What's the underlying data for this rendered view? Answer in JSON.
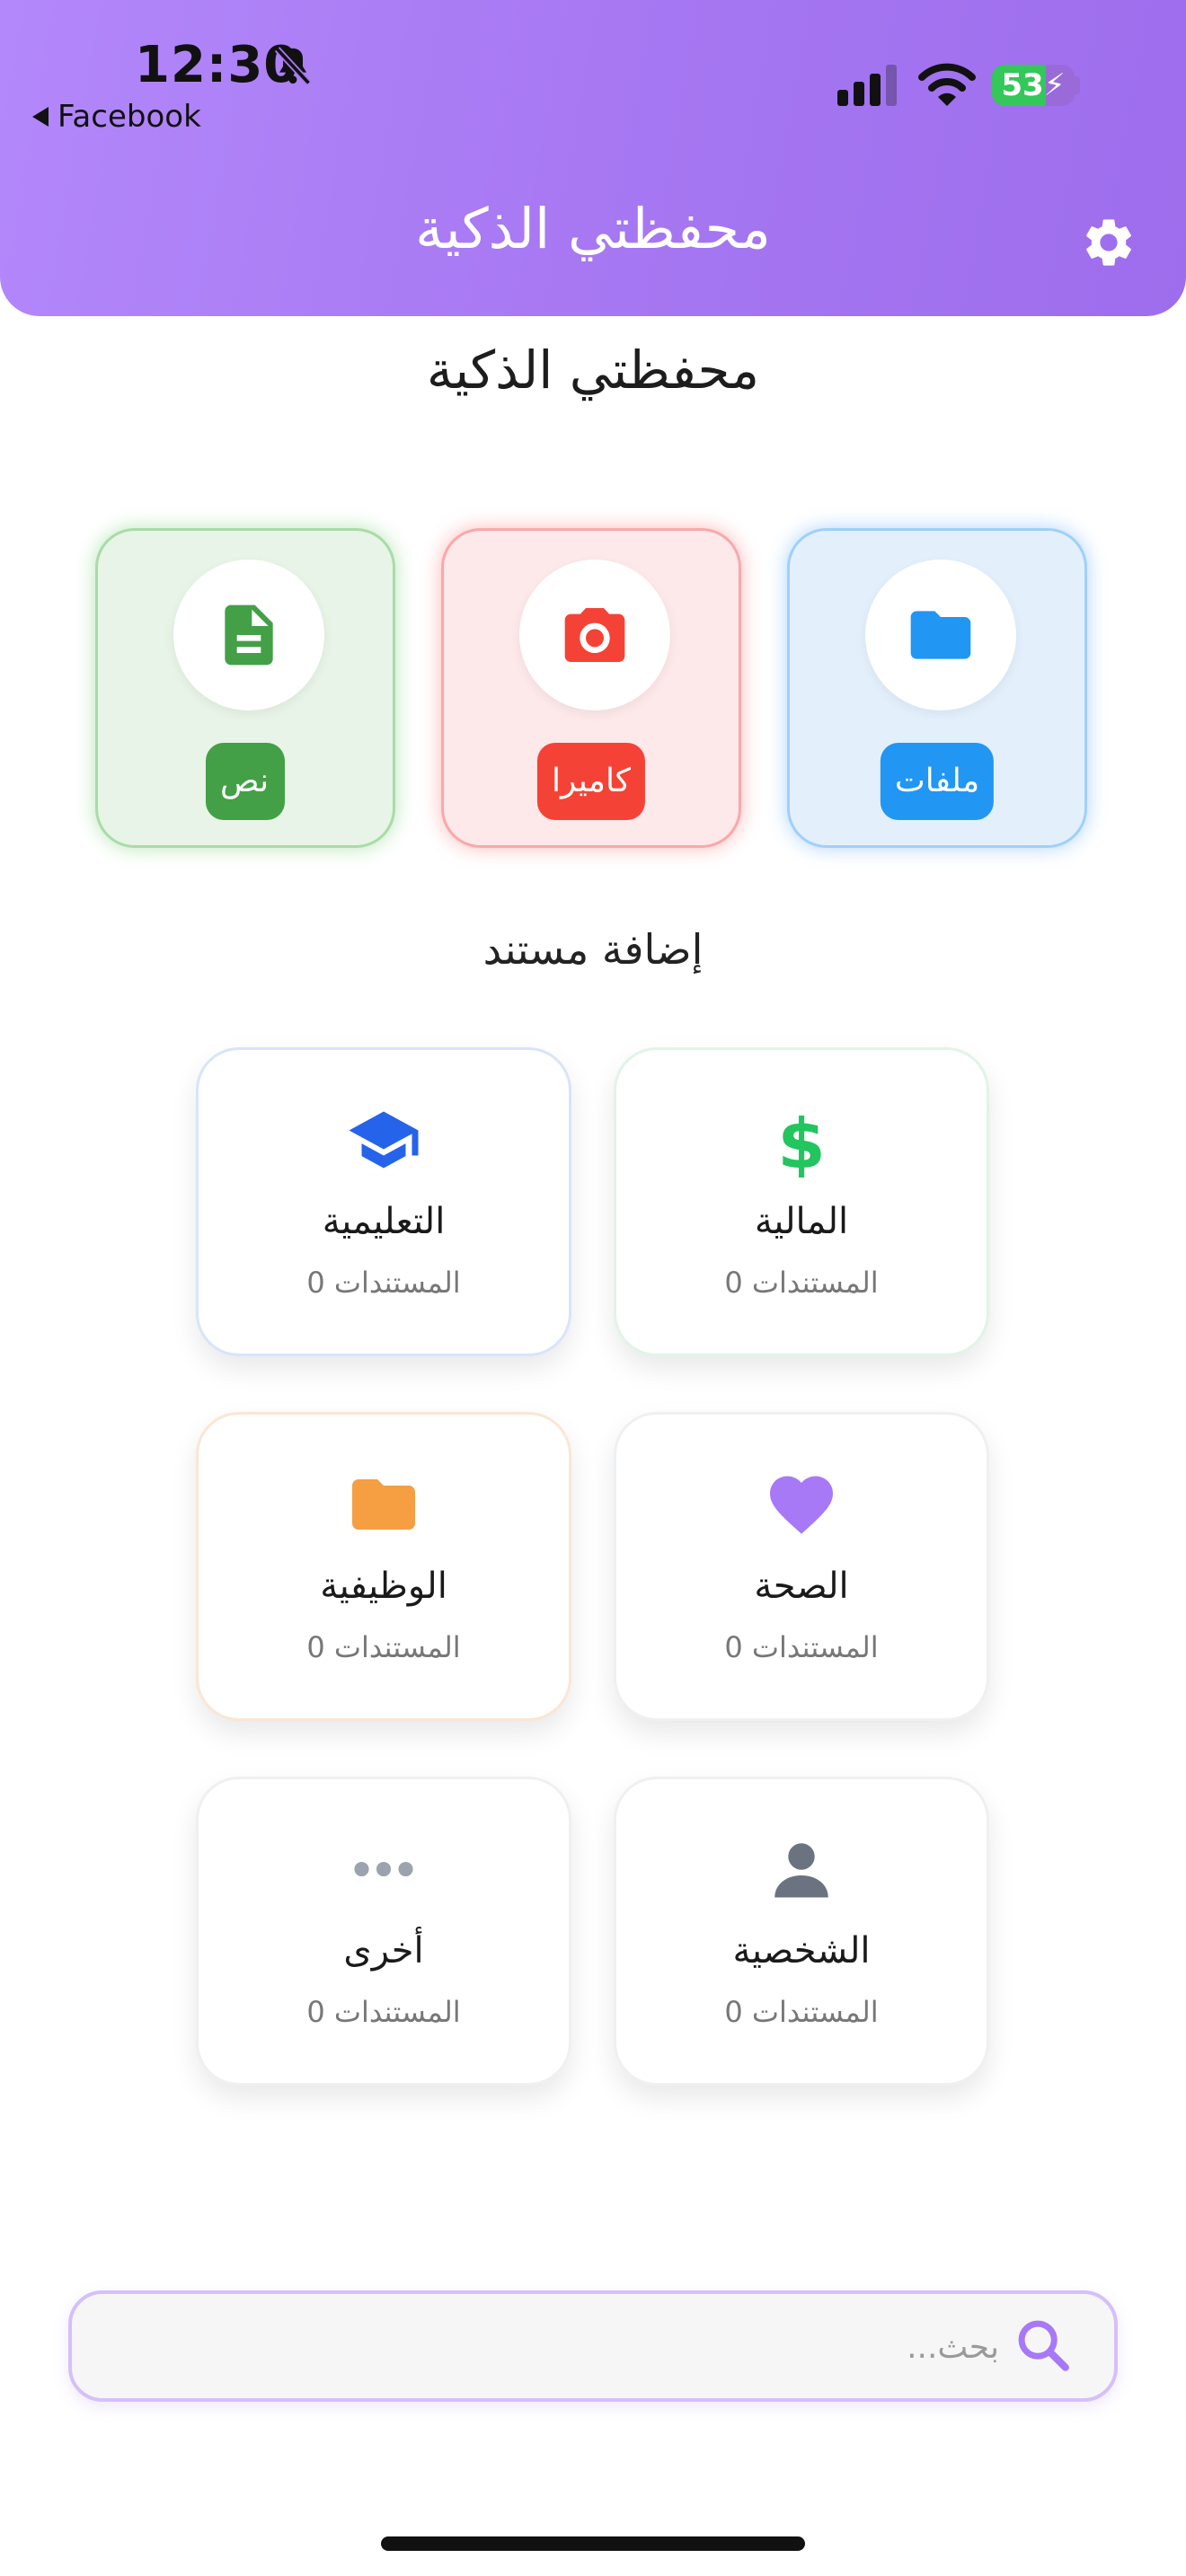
{
  "status_bar": {
    "time": "12:30",
    "back_app": "Facebook",
    "battery": "53"
  },
  "header": {
    "title": "محفظتي الذكية"
  },
  "page": {
    "title": "محفظتي الذكية",
    "section_title": "إضافة مستند"
  },
  "actions": [
    {
      "label": "ملفات",
      "icon": "folder-icon",
      "color": "#2196f3"
    },
    {
      "label": "كاميرا",
      "icon": "camera-icon",
      "color": "#f44336"
    },
    {
      "label": "نص",
      "icon": "text-document-icon",
      "color": "#43a047"
    }
  ],
  "categories": [
    {
      "name": "المالية",
      "count": "المستندات 0",
      "icon": "dollar-icon",
      "color": "#22c55e"
    },
    {
      "name": "التعليمية",
      "count": "المستندات 0",
      "icon": "graduation-cap-icon",
      "color": "#2563eb"
    },
    {
      "name": "الصحة",
      "count": "المستندات 0",
      "icon": "heart-icon",
      "color": "#a779f6"
    },
    {
      "name": "الوظيفية",
      "count": "المستندات 0",
      "icon": "folder-icon",
      "color": "#f59e42"
    },
    {
      "name": "الشخصية",
      "count": "المستندات 0",
      "icon": "person-icon",
      "color": "#6b7280"
    },
    {
      "name": "أخرى",
      "count": "المستندات 0",
      "icon": "more-dots-icon",
      "color": "#9ca3af"
    }
  ],
  "search": {
    "placeholder": "بحث..."
  }
}
